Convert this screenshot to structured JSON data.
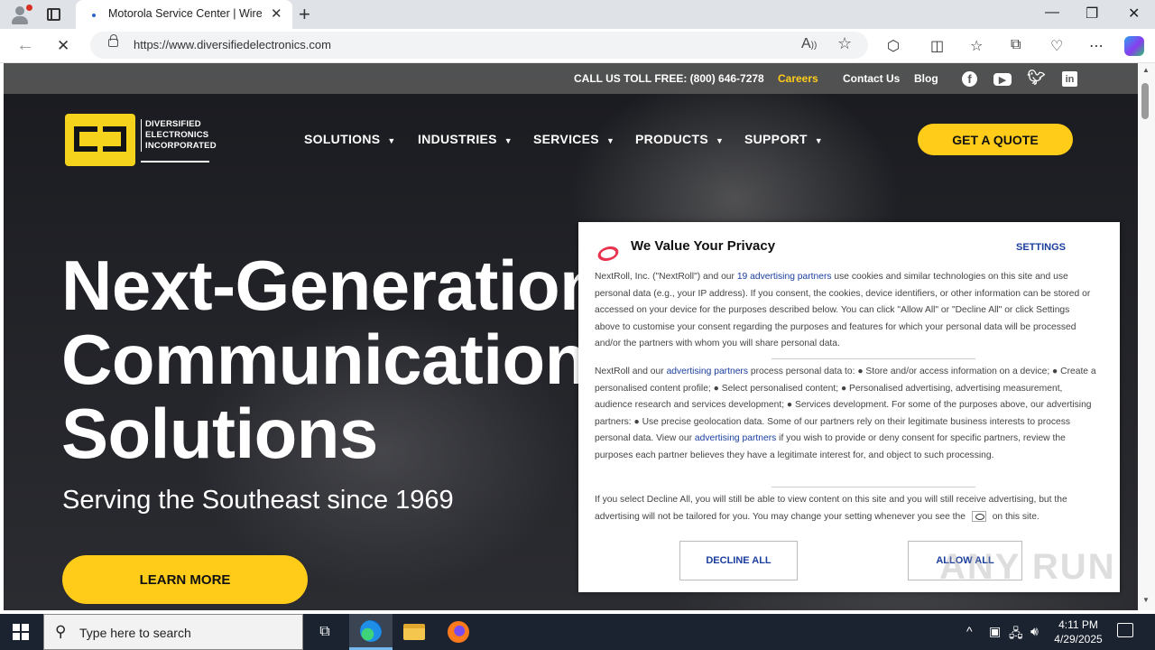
{
  "browser": {
    "tab_title": "Motorola Service Center | Wireless",
    "url": "https://www.diversifiedelectronics.com",
    "new_tab_glyph": "+",
    "close_glyph": "✕",
    "win_minimize": "—",
    "win_restore": "❐",
    "win_close": "✕",
    "back_glyph": "←",
    "stop_glyph": "✕",
    "toolbar_icons": [
      "read-aloud-icon",
      "favorite-star-icon",
      "extensions-icon",
      "split-screen-icon",
      "favorites-icon",
      "collections-icon",
      "performance-icon",
      "more-icon",
      "copilot-icon"
    ]
  },
  "site": {
    "topbar": {
      "call_text": "CALL US TOLL FREE: (800) 646-7278",
      "careers": "Careers",
      "contact": "Contact Us",
      "blog": "Blog",
      "social": [
        "facebook-icon",
        "youtube-icon",
        "twitter-icon",
        "linkedin-icon"
      ]
    },
    "logo": {
      "line1": "DIVERSIFIED",
      "line2": "ELECTRONICS",
      "line3": "INCORPORATED"
    },
    "nav": [
      "SOLUTIONS",
      "INDUSTRIES",
      "SERVICES",
      "PRODUCTS",
      "SUPPORT"
    ],
    "quote_button": "GET A QUOTE",
    "hero": {
      "line1": "Next-Generation",
      "line2": "Communication",
      "line3": "Solutions",
      "subtitle": "Serving the Southeast since 1969",
      "cta": "LEARN MORE"
    }
  },
  "privacy_modal": {
    "title": "We Value Your Privacy",
    "settings": "SETTINGS",
    "p1_a": "NextRoll, Inc. (\"NextRoll\") and our ",
    "p1_link": "19 advertising partners",
    "p1_b": " use cookies and similar technologies on this site and use personal data (e.g., your IP address). If you consent, the cookies, device identifiers, or other information can be stored or accessed on your device for the purposes described below. You can click \"Allow All\" or \"Decline All\" or click Settings above to customise your consent regarding the purposes and features for which your personal data will be processed and/or the partners with whom you will share personal data.",
    "p2_a": "NextRoll and our ",
    "p2_link1": "advertising partners",
    "p2_b": " process personal data to: ● Store and/or access information on a device; ● Create a personalised content profile; ● Select personalised content; ● Personalised advertising, advertising measurement, audience research and services development; ● Services development. For some of the purposes above, our advertising partners: ● Use precise geolocation data. Some of our partners rely on their legitimate business interests to process personal data. View our ",
    "p2_link2": "advertising partners",
    "p2_c": " if you wish to provide or deny consent for specific partners, review the purposes each partner believes they have a legitimate interest for, and object to such processing.",
    "p3_a": "If you select Decline All, you will still be able to view content on this site and you will still receive advertising, but the advertising will not be tailored for you. You may change your setting whenever you see the ",
    "p3_b": " on this site.",
    "decline": "DECLINE ALL",
    "allow": "ALLOW ALL",
    "watermark": "ANY RUN"
  },
  "taskbar": {
    "search_placeholder": "Type here to search",
    "time": "4:11 PM",
    "date": "4/29/2025",
    "apps": [
      "task-view-icon",
      "edge-icon",
      "file-explorer-icon",
      "firefox-icon"
    ]
  }
}
